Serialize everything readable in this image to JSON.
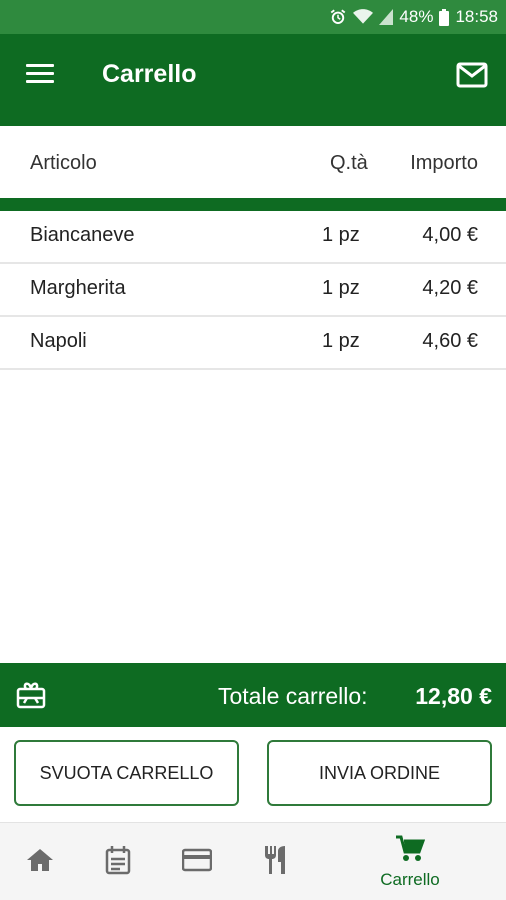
{
  "status_bar": {
    "battery": "48%",
    "time": "18:58",
    "icons": [
      "alarm-icon",
      "wifi-icon",
      "signal-icon",
      "battery-icon"
    ]
  },
  "app_bar": {
    "title": "Carrello",
    "menu_icon": "menu-icon",
    "mail_icon": "mail-icon"
  },
  "table": {
    "headers": {
      "article": "Articolo",
      "qty": "Q.tà",
      "amount": "Importo"
    },
    "items": [
      {
        "name": "Biancaneve",
        "qty": "1 pz",
        "price": "4,00 €"
      },
      {
        "name": "Margherita",
        "qty": "1 pz",
        "price": "4,20 €"
      },
      {
        "name": "Napoli",
        "qty": "1 pz",
        "price": "4,60 €"
      }
    ]
  },
  "total": {
    "label": "Totale carrello:",
    "value": "12,80 €",
    "icon": "gift-card-icon"
  },
  "buttons": {
    "empty": "SVUOTA CARRELLO",
    "send": "INVIA ORDINE"
  },
  "bottom_nav": {
    "items": [
      {
        "icon": "home-icon",
        "label": ""
      },
      {
        "icon": "calendar-icon",
        "label": ""
      },
      {
        "icon": "credit-card-icon",
        "label": ""
      },
      {
        "icon": "restaurant-icon",
        "label": ""
      },
      {
        "icon": "cart-icon",
        "label": "Carrello",
        "active": true
      }
    ]
  },
  "colors": {
    "primary": "#0e6b22",
    "status_bar": "#2f8a3e",
    "active": "#0e6b22"
  }
}
